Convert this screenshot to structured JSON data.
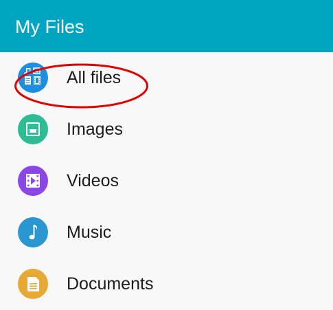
{
  "app": {
    "title": "My Files"
  },
  "categories": [
    {
      "label": "All files",
      "icon": "all-files-icon",
      "color": "#1d8fe0"
    },
    {
      "label": "Images",
      "icon": "image-icon",
      "color": "#2ebc97"
    },
    {
      "label": "Videos",
      "icon": "video-icon",
      "color": "#8a47e5"
    },
    {
      "label": "Music",
      "icon": "music-note-icon",
      "color": "#2a97d0"
    },
    {
      "label": "Documents",
      "icon": "document-icon",
      "color": "#e6aa34"
    }
  ],
  "annotation": {
    "highlight_color": "#e00000"
  }
}
